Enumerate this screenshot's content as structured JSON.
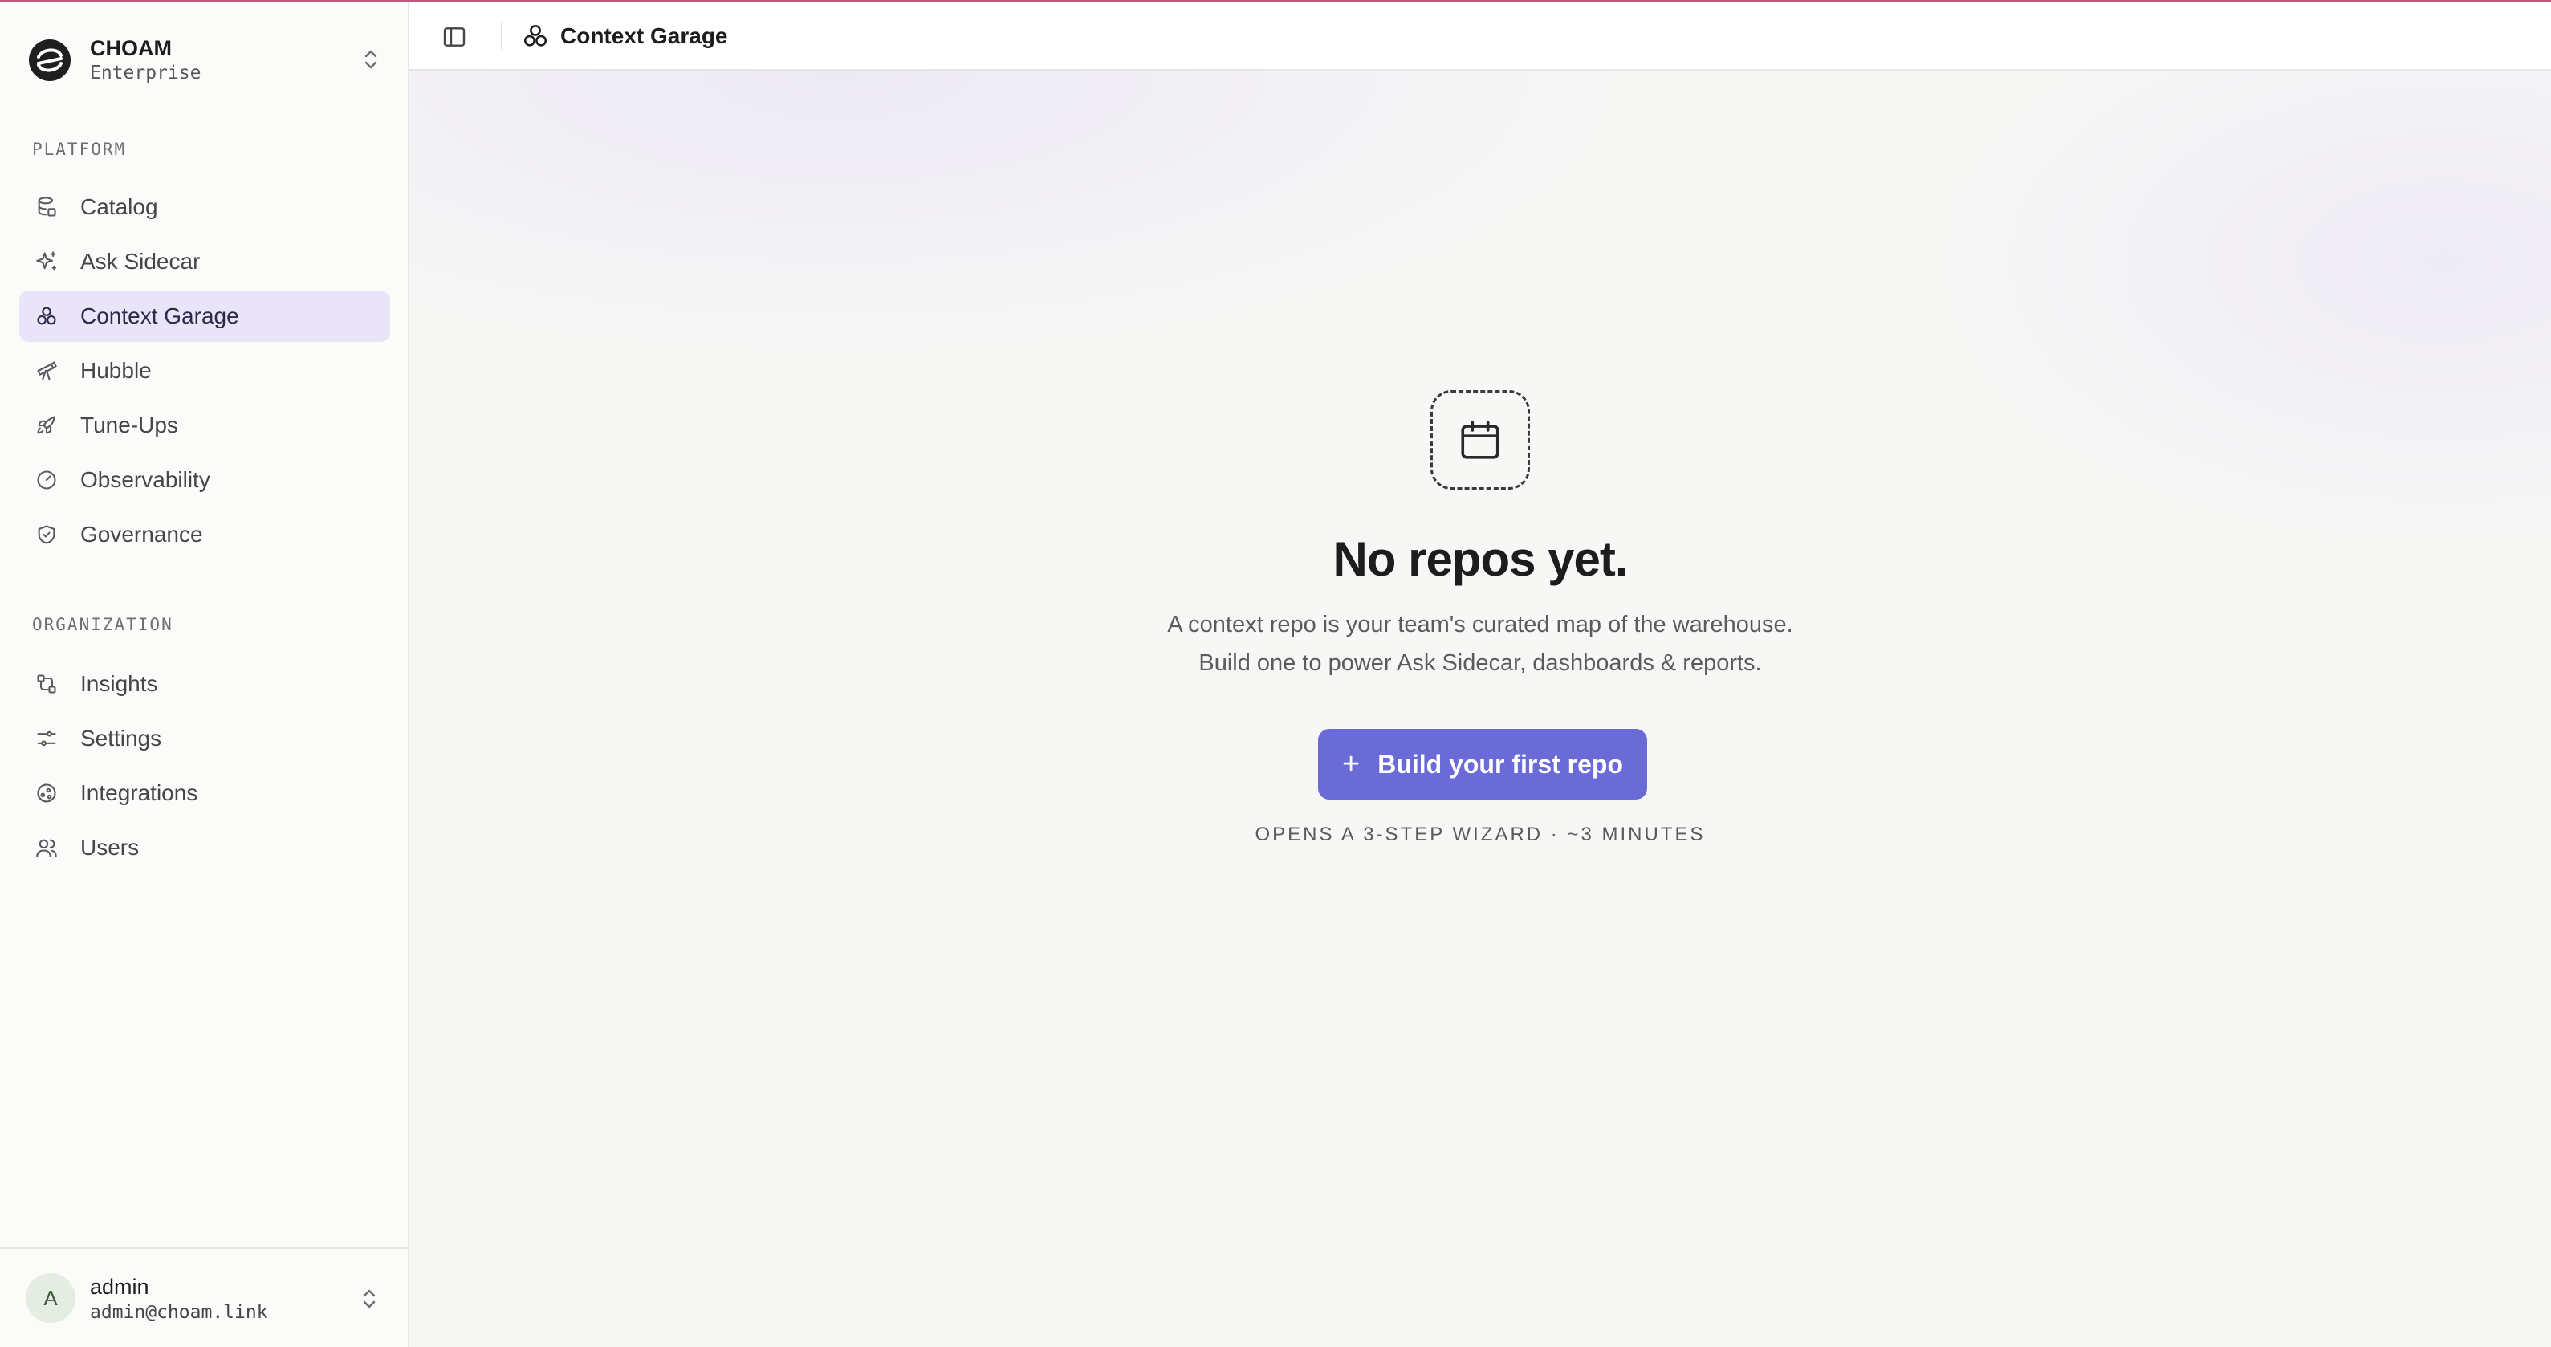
{
  "org": {
    "name": "CHOAM",
    "plan": "Enterprise",
    "switcher_icon": "chevrons-up-down-icon"
  },
  "sidebar": {
    "platform_label": "PLATFORM",
    "platform_items": [
      {
        "label": "Catalog",
        "icon": "database-icon"
      },
      {
        "label": "Ask Sidecar",
        "icon": "sparkles-icon"
      },
      {
        "label": "Context Garage",
        "icon": "boxes-icon",
        "active": true
      },
      {
        "label": "Hubble",
        "icon": "telescope-icon"
      },
      {
        "label": "Tune-Ups",
        "icon": "rocket-icon"
      },
      {
        "label": "Observability",
        "icon": "gauge-icon"
      },
      {
        "label": "Governance",
        "icon": "shield-icon"
      }
    ],
    "organization_label": "ORGANIZATION",
    "organization_items": [
      {
        "label": "Insights",
        "icon": "workflow-icon"
      },
      {
        "label": "Settings",
        "icon": "sliders-icon"
      },
      {
        "label": "Integrations",
        "icon": "integrations-icon"
      },
      {
        "label": "Users",
        "icon": "users-icon"
      }
    ]
  },
  "user": {
    "initial": "A",
    "name": "admin",
    "email": "admin@choam.link"
  },
  "header": {
    "title": "Context Garage"
  },
  "empty_state": {
    "icon": "calendar-icon",
    "title": "No repos yet.",
    "description_line1": "A context repo is your team's curated map of the warehouse.",
    "description_line2": "Build one to power Ask Sidecar, dashboards & reports.",
    "cta_label": "Build your first repo",
    "hint": "OPENS A 3-STEP WIZARD · ~3 MINUTES"
  },
  "colors": {
    "accent": "#6a6bd6",
    "active_nav_bg": "#e9e4f7",
    "top_border": "#c0577e"
  }
}
